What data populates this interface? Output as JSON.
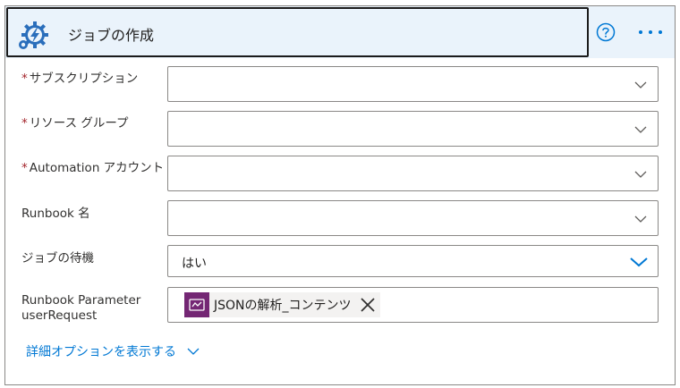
{
  "header": {
    "title": "ジョブの作成",
    "icon": "automation-gear-icon",
    "help_icon": "question-circle-icon",
    "more_icon": "ellipsis-icon",
    "accent": "#0078d4"
  },
  "fields": [
    {
      "label": "サブスクリプション",
      "required": true,
      "value": ""
    },
    {
      "label": "リソース グループ",
      "required": true,
      "value": ""
    },
    {
      "label": "Automation アカウント",
      "required": true,
      "value": ""
    },
    {
      "label": "Runbook 名",
      "required": false,
      "value": ""
    },
    {
      "label": "ジョブの待機",
      "required": false,
      "value": "はい"
    }
  ],
  "parameter": {
    "label": "Runbook Parameter userRequest",
    "token_text": "JSONの解析_コンテンツ",
    "token_icon_color": "#742774"
  },
  "advanced": {
    "label": "詳細オプションを表示する"
  },
  "required_marker": "*"
}
